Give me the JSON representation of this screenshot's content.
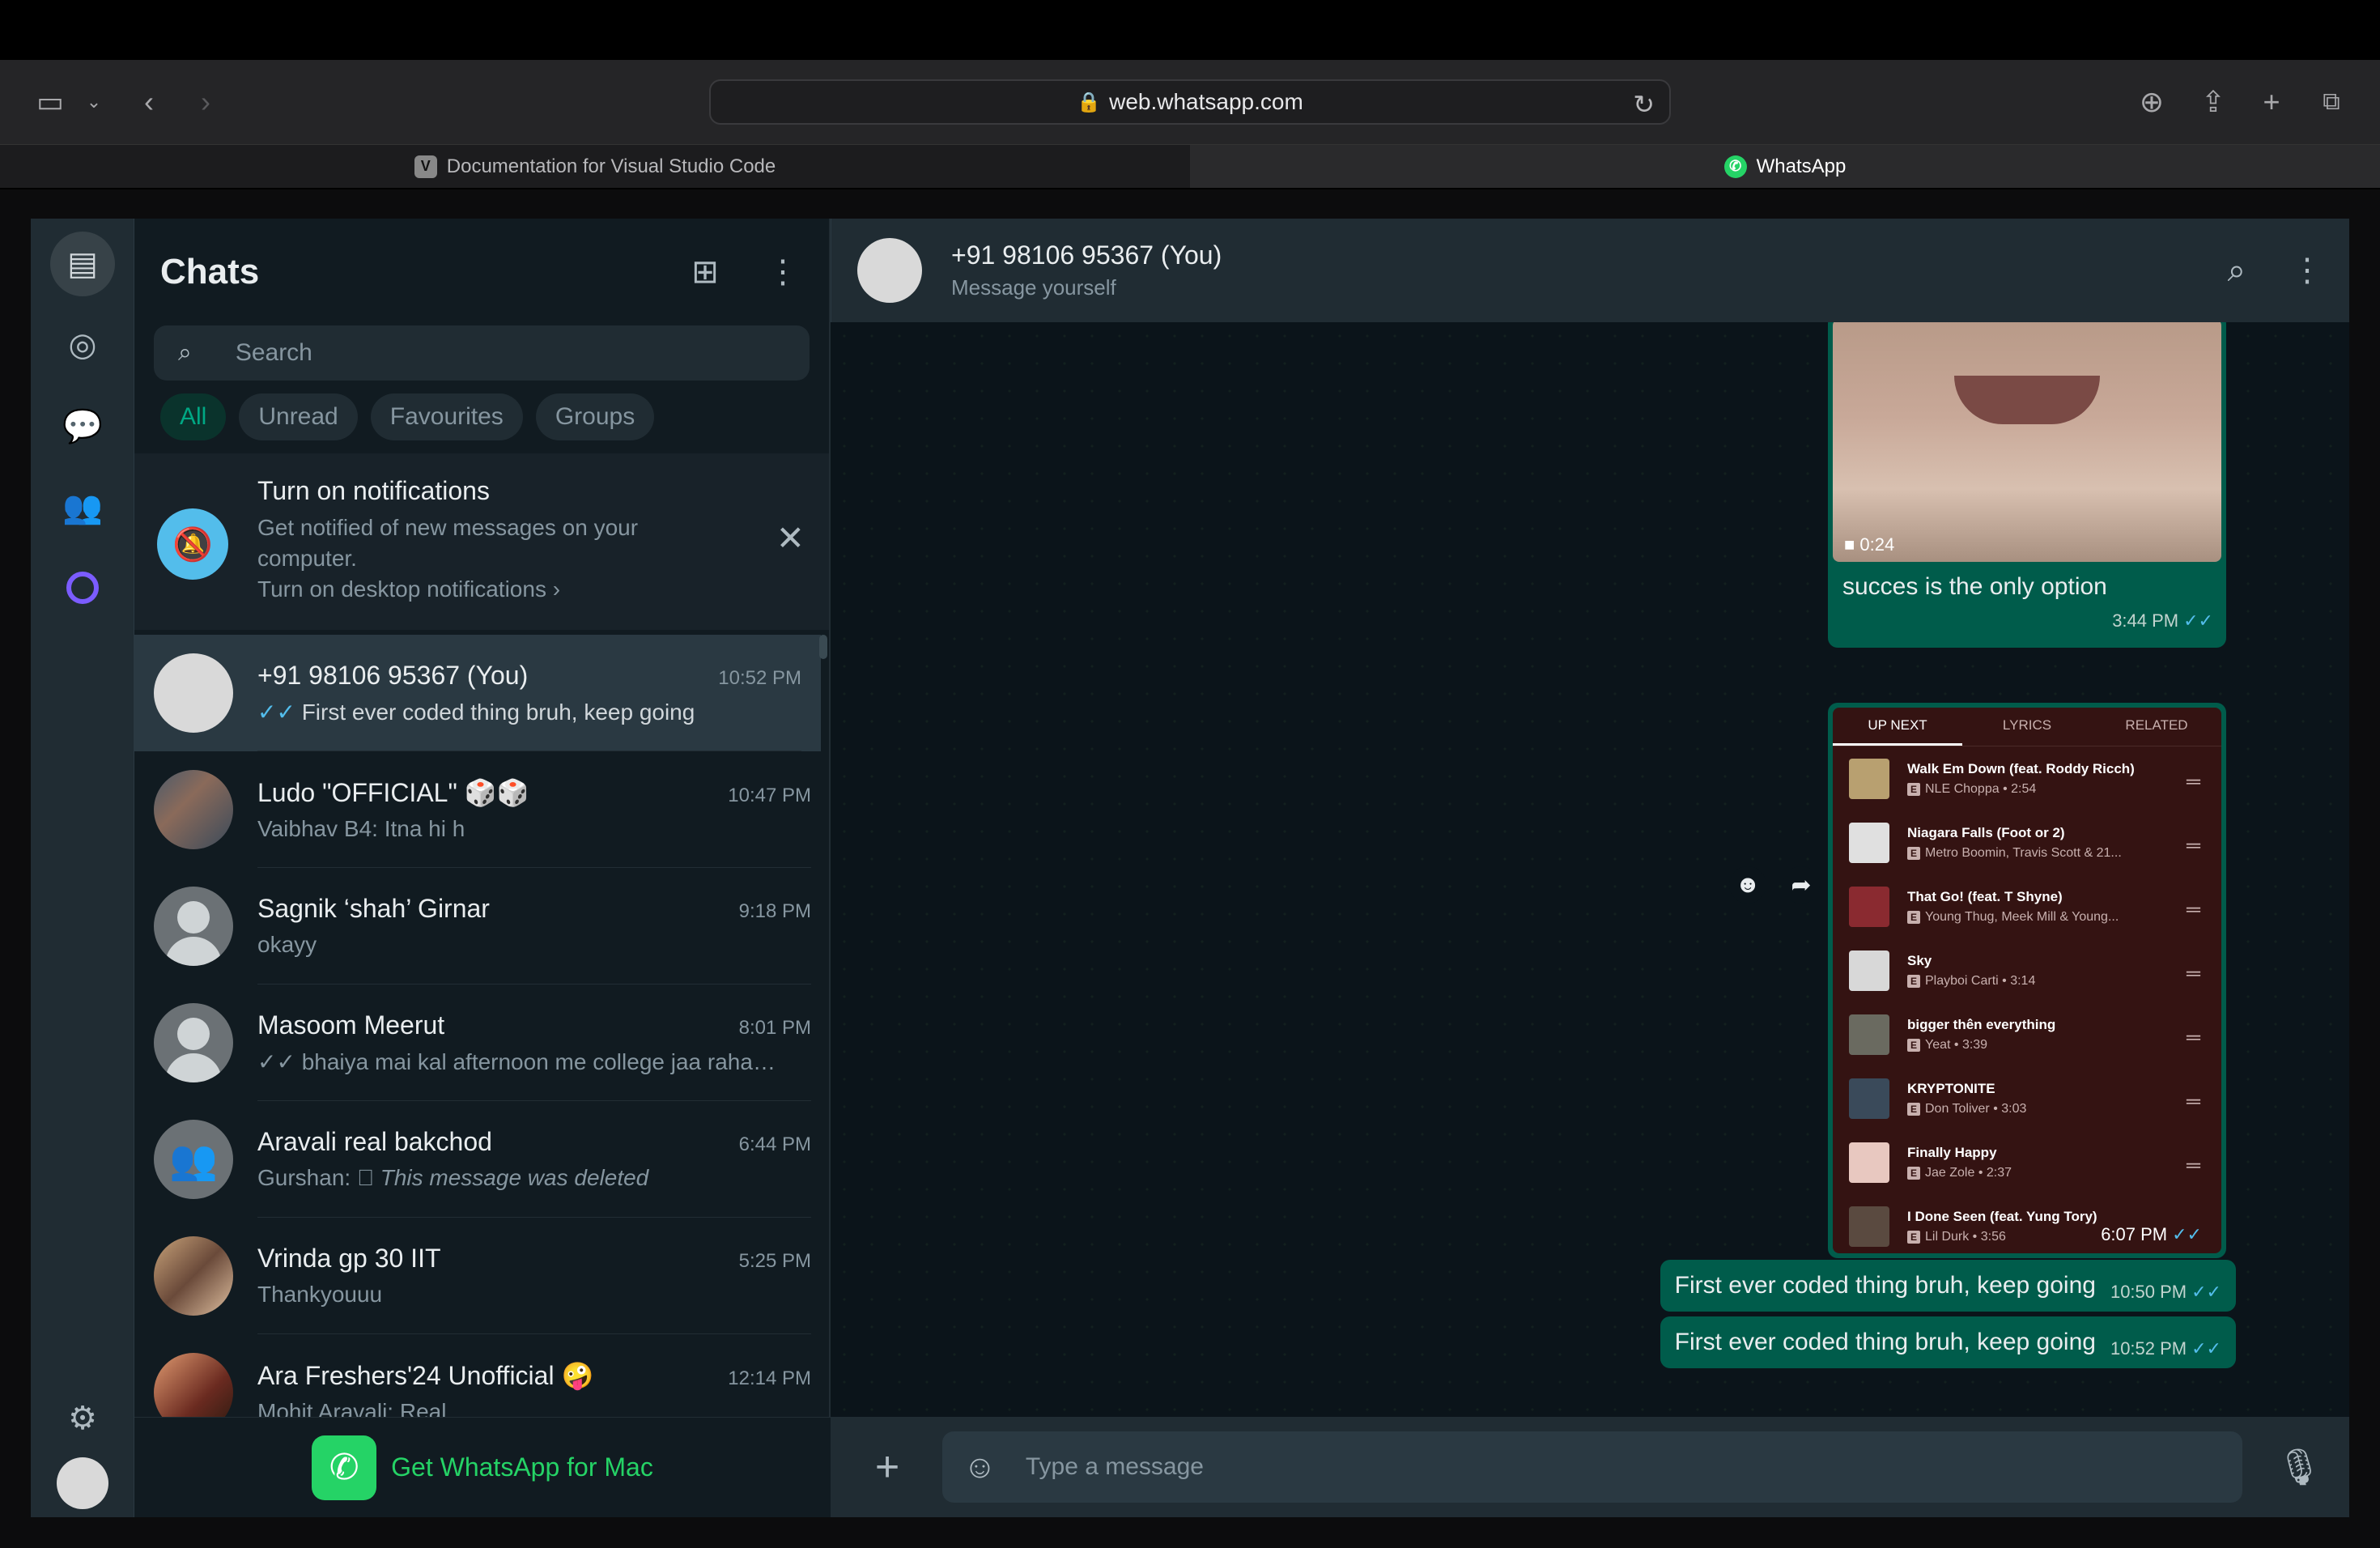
{
  "browser": {
    "url": "web.whatsapp.com",
    "tabs": [
      {
        "label": "Documentation for Visual Studio Code",
        "favicon": "V",
        "active": false
      },
      {
        "label": "WhatsApp",
        "favicon": "whatsapp-icon",
        "active": true
      }
    ]
  },
  "chatlist": {
    "title": "Chats",
    "search_placeholder": "Search",
    "filters": [
      "All",
      "Unread",
      "Favourites",
      "Groups"
    ],
    "notification": {
      "title": "Turn on notifications",
      "text": "Get notified of new messages on your computer.",
      "link": "Turn on desktop notifications"
    },
    "chats": [
      {
        "name": "+91 98106 95367 (You)",
        "time": "10:52 PM",
        "ticks": "✓✓",
        "preview": "First ever coded thing bruh, keep going"
      },
      {
        "name": "Ludo \"OFFICIAL\" 🎲🎲",
        "time": "10:47 PM",
        "ticks": "",
        "preview": "Vaibhav B4: Itna hi h"
      },
      {
        "name": "Sagnik ‘shah’ Girnar",
        "time": "9:18 PM",
        "ticks": "",
        "preview": "okayy"
      },
      {
        "name": "Masoom Meerut",
        "time": "8:01 PM",
        "ticks": "✓✓",
        "preview": "bhaiya mai kal afternoon me college jaa raha ..."
      },
      {
        "name": "Aravali real bakchod",
        "time": "6:44 PM",
        "sender": "Gurshan:",
        "preview": "This message was deleted"
      },
      {
        "name": "Vrinda gp 30 IIT",
        "time": "5:25 PM",
        "ticks": "",
        "preview": "Thankyouuu"
      },
      {
        "name": "Ara Freshers'24 Unofficial 🤪",
        "time": "12:14 PM",
        "ticks": "",
        "preview": "Mohit Aravali: Real"
      }
    ],
    "promo": "Get WhatsApp for Mac"
  },
  "conversation": {
    "name": "+91 98106 95367 (You)",
    "subtitle": "Message yourself",
    "video_message": {
      "duration": "0:24",
      "caption": "succes is the only option",
      "time": "3:44 PM",
      "ticks": "✓✓"
    },
    "image_message": {
      "tabs": [
        "UP NEXT",
        "LYRICS",
        "RELATED"
      ],
      "songs": [
        {
          "title": "Walk Em Down (feat. Roddy Ricch)",
          "artist": "NLE Choppa • 2:54",
          "color": "#b8a070"
        },
        {
          "title": "Niagara Falls (Foot or 2)",
          "artist": "Metro Boomin, Travis Scott & 21...",
          "color": "#e0e0e0"
        },
        {
          "title": "That Go! (feat. T Shyne)",
          "artist": "Young Thug, Meek Mill & Young...",
          "color": "#8a2a30"
        },
        {
          "title": "Sky",
          "artist": "Playboi Carti • 3:14",
          "color": "#d8d8d8"
        },
        {
          "title": "bigger thên everything",
          "artist": "Yeat • 3:39",
          "color": "#6a6a60"
        },
        {
          "title": "KRYPTONITE",
          "artist": "Don Toliver • 3:03",
          "color": "#3a4a5a"
        },
        {
          "title": "Finally Happy",
          "artist": "Jae Zole • 2:37",
          "color": "#e8c8c0"
        },
        {
          "title": "I Done Seen (feat. Yung Tory)",
          "artist": "Lil Durk • 3:56",
          "color": "#5a4a40"
        }
      ],
      "time": "6:07 PM",
      "ticks": "✓✓"
    },
    "text_messages": [
      {
        "text": "First ever coded thing bruh, keep going",
        "time": "10:50 PM",
        "ticks": "✓✓"
      },
      {
        "text": "First ever coded thing bruh, keep going",
        "time": "10:52 PM",
        "ticks": "✓✓"
      }
    ],
    "composer_placeholder": "Type a message"
  }
}
